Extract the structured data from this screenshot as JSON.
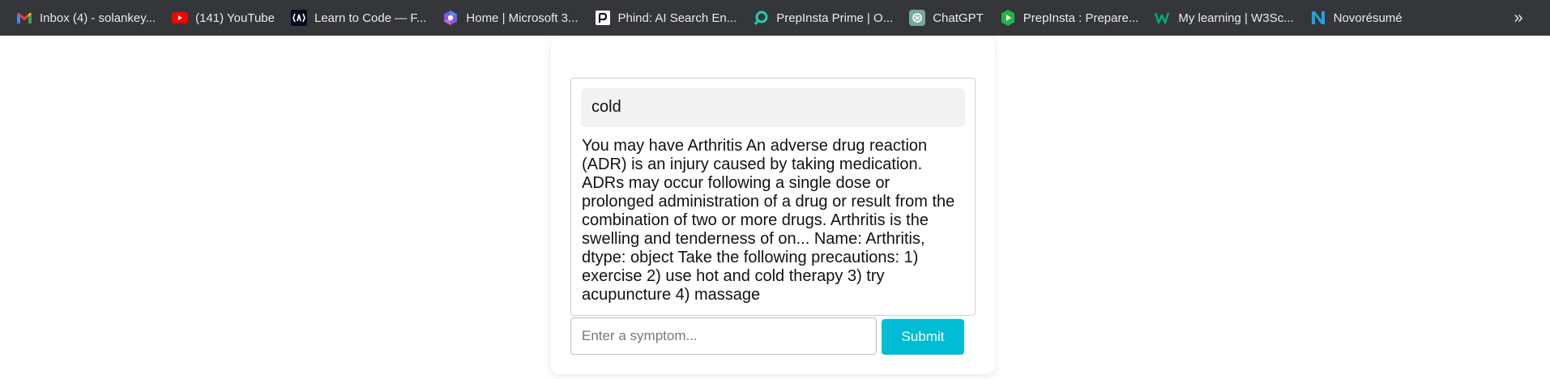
{
  "bookmarks": [
    {
      "label": "Inbox (4) - solankey...",
      "icon": "gmail-icon"
    },
    {
      "label": "(141) YouTube",
      "icon": "youtube-icon"
    },
    {
      "label": "Learn to Code — F...",
      "icon": "freecodecamp-icon"
    },
    {
      "label": "Home | Microsoft 3...",
      "icon": "microsoft365-icon"
    },
    {
      "label": "Phind: AI Search En...",
      "icon": "phind-icon"
    },
    {
      "label": "PrepInsta Prime | O...",
      "icon": "prepinsta-prime-icon"
    },
    {
      "label": "ChatGPT",
      "icon": "chatgpt-icon"
    },
    {
      "label": "PrepInsta : Prepare...",
      "icon": "prepinsta-icon"
    },
    {
      "label": "My learning | W3Sc...",
      "icon": "w3schools-icon"
    },
    {
      "label": "Novorésumé",
      "icon": "novoresume-icon"
    }
  ],
  "overflow_label": "»",
  "chat": {
    "user_message": "cold",
    "bot_message": "You may have Arthritis An adverse drug reaction (ADR) is an injury caused by taking medication. ADRs may occur following a single dose or prolonged administration of a drug or result from the combination of two or more drugs. Arthritis is the swelling and tenderness of on... Name: Arthritis, dtype: object Take the following precautions: 1) exercise 2) use hot and cold therapy 3) try acupuncture 4) massage"
  },
  "form": {
    "placeholder": "Enter a symptom...",
    "value": "",
    "submit_label": "Submit"
  },
  "colors": {
    "bookmarks_bar": "#35363a",
    "accent": "#00bcd4",
    "user_bubble": "#f2f2f2"
  }
}
